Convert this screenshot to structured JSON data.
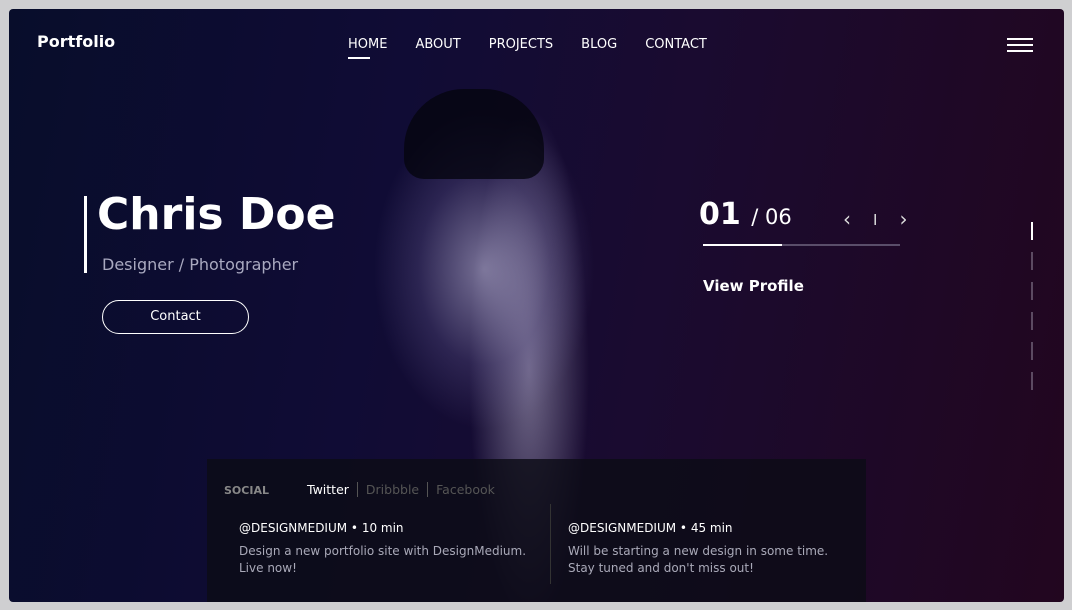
{
  "brand": "Portfolio",
  "nav": [
    "HOME",
    "ABOUT",
    "PROJECTS",
    "BLOG",
    "CONTACT"
  ],
  "hero": {
    "name": "Chris Doe",
    "subtitle": "Designer / Photographer",
    "contact_button": "Contact"
  },
  "slider": {
    "current": "01",
    "total": "/ 06",
    "progress_fraction": 0.4,
    "view_profile": "View Profile",
    "pages": 6,
    "active_page": 1,
    "separator": "I"
  },
  "social": {
    "label": "SOCIAL",
    "tabs": [
      "Twitter",
      "Dribbble",
      "Facebook"
    ],
    "active_tab": "Twitter",
    "posts": [
      {
        "header": "@DESIGNMEDIUM  •  10 min",
        "text": "Design a new portfolio site with DesignMedium. Live now!"
      },
      {
        "header": "@DESIGNMEDIUM  •  45 min",
        "text": "Will be starting a new design in some time. Stay tuned and don't miss out!"
      }
    ]
  }
}
